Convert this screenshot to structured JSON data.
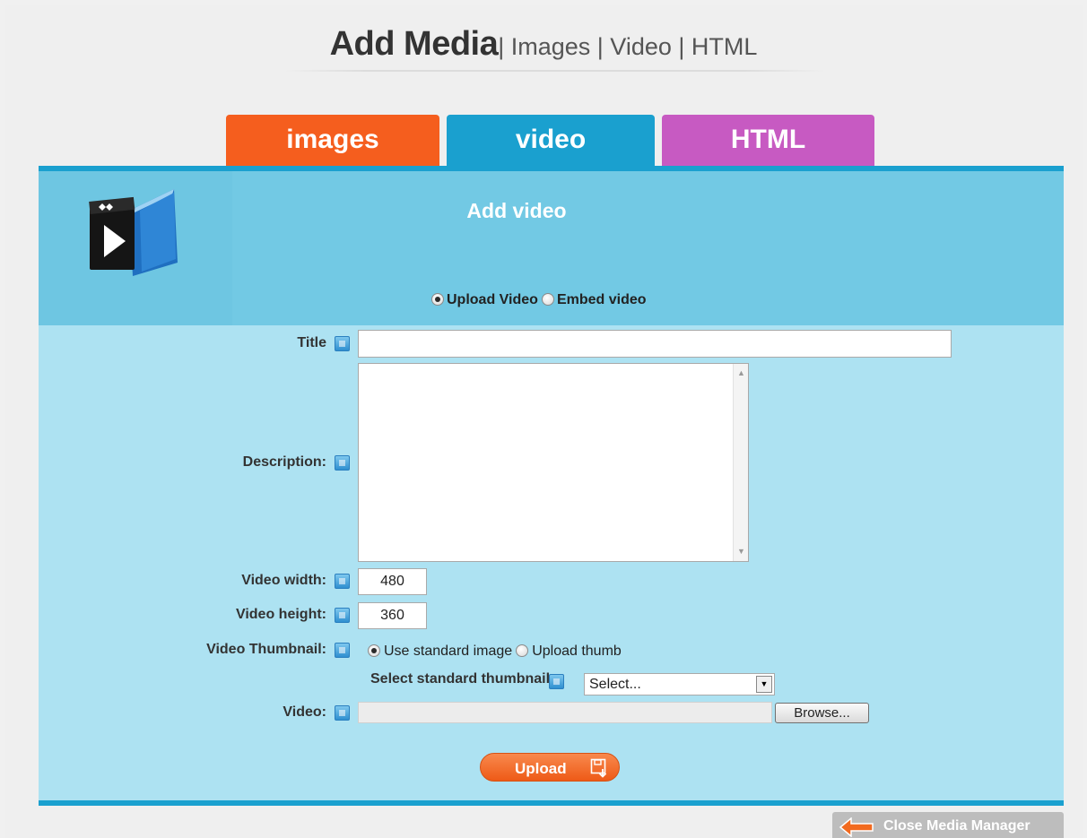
{
  "header": {
    "title": "Add Media",
    "nav": "| Images | Video | HTML"
  },
  "tabs": [
    {
      "label": "images",
      "color": "#f55e1e"
    },
    {
      "label": "video",
      "color": "#1aa0cf",
      "active": true
    },
    {
      "label": "HTML",
      "color": "#c75ac2"
    }
  ],
  "panel": {
    "title": "Add video",
    "mode_options": [
      {
        "label": "Upload Video",
        "checked": true
      },
      {
        "label": "Embed video",
        "checked": false
      }
    ]
  },
  "form": {
    "title_label": "Title",
    "title_value": "",
    "description_label": "Description:",
    "description_value": "",
    "width_label": "Video width:",
    "width_value": "480",
    "height_label": "Video height:",
    "height_value": "360",
    "thumbnail_label": "Video Thumbnail:",
    "thumbnail_options": [
      {
        "label": "Use standard image",
        "checked": true
      },
      {
        "label": "Upload thumb",
        "checked": false
      }
    ],
    "standard_thumb_label": "Select standard thumbnail:",
    "standard_thumb_selected": "Select...",
    "video_label": "Video:",
    "video_value": "",
    "browse_label": "Browse..."
  },
  "actions": {
    "upload_label": "Upload",
    "close_label": "Close Media Manager"
  },
  "colors": {
    "accent_orange": "#f55e1e",
    "accent_blue": "#1aa0cf",
    "accent_purple": "#c75ac2",
    "panel_head": "#72c9e4",
    "panel_body": "#ade2f2"
  },
  "icons": [
    "video-clapper-icon",
    "help-icon",
    "save-disk-icon",
    "back-arrow-icon"
  ]
}
